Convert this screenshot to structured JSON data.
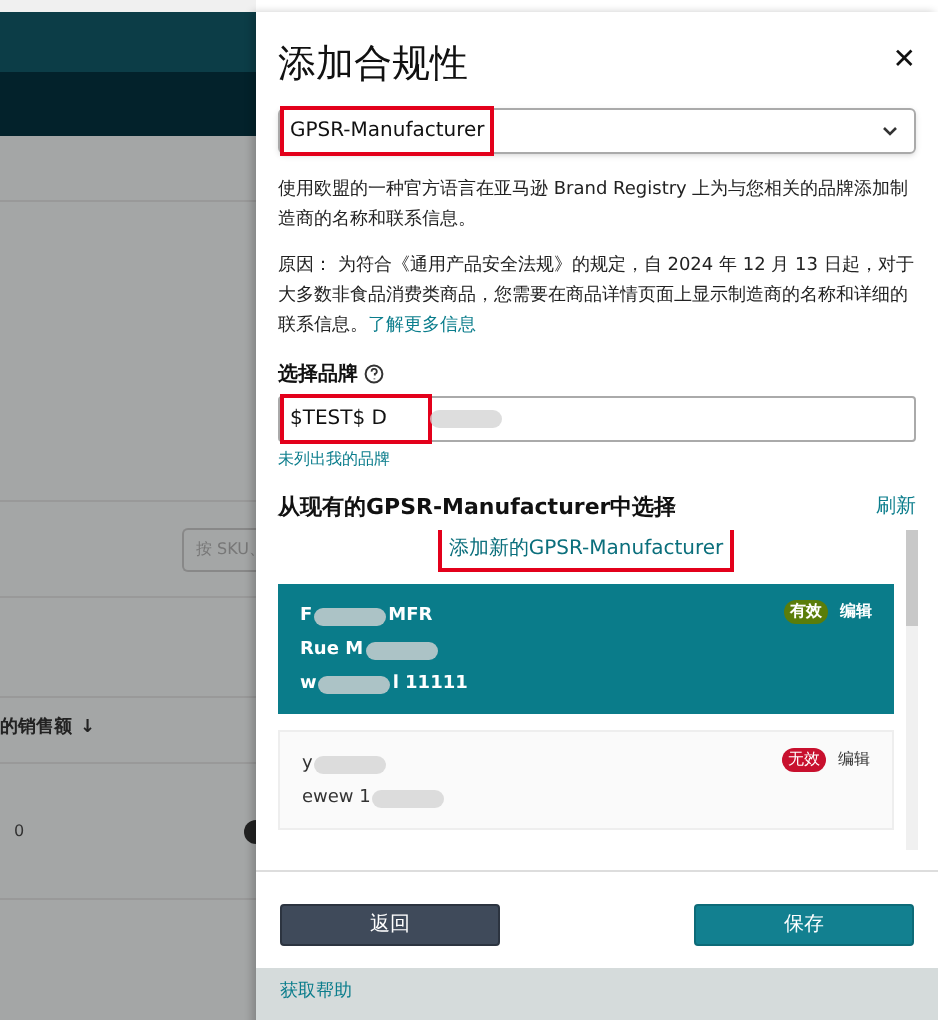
{
  "background_page": {
    "search": {
      "placeholder": "按 SKU、"
    },
    "column_header": "的销售额",
    "sort_arrow": "↓",
    "cell": "0"
  },
  "panel": {
    "title": "添加合规性",
    "close": "✕",
    "type_select": {
      "value": "GPSR-Manufacturer",
      "highlighted": true
    },
    "intro": "使用欧盟的一种官方语言在亚马逊 Brand Registry 上为与您相关的品牌添加制造商的名称和联系信息。",
    "reason": "原因： 为符合《通用产品安全法规》的规定，自 2024 年 12 月 13 日起，对于大多数非食品消费类商品，您需要在商品详情页面上显示制造商的名称和详细的联系信息。",
    "learn_more": "了解更多信息",
    "brand_label": "选择品牌",
    "brand_field": {
      "value": "$TEST$ D",
      "highlighted": true
    },
    "brand_missing_link": "未列出我的品牌",
    "list_heading": "从现有的GPSR-Manufacturer中选择",
    "refresh": "刷新",
    "add_new": {
      "label": "添加新的GPSR-Manufacturer",
      "highlighted": true
    },
    "entries": [
      {
        "selected": true,
        "lines": [
          [
            "F",
            "MFR"
          ],
          [
            "Rue M"
          ],
          [
            "w",
            "l 11111"
          ]
        ],
        "status": "有效",
        "color": "#5a7d0a",
        "edit": "编辑"
      },
      {
        "selected": false,
        "lines": [
          [
            "y"
          ],
          [
            "ewew 1"
          ]
        ],
        "status": "无效",
        "color": "#c8102e",
        "edit": "编辑"
      }
    ],
    "back": "返回",
    "save": "保存",
    "help": "获取帮助"
  }
}
